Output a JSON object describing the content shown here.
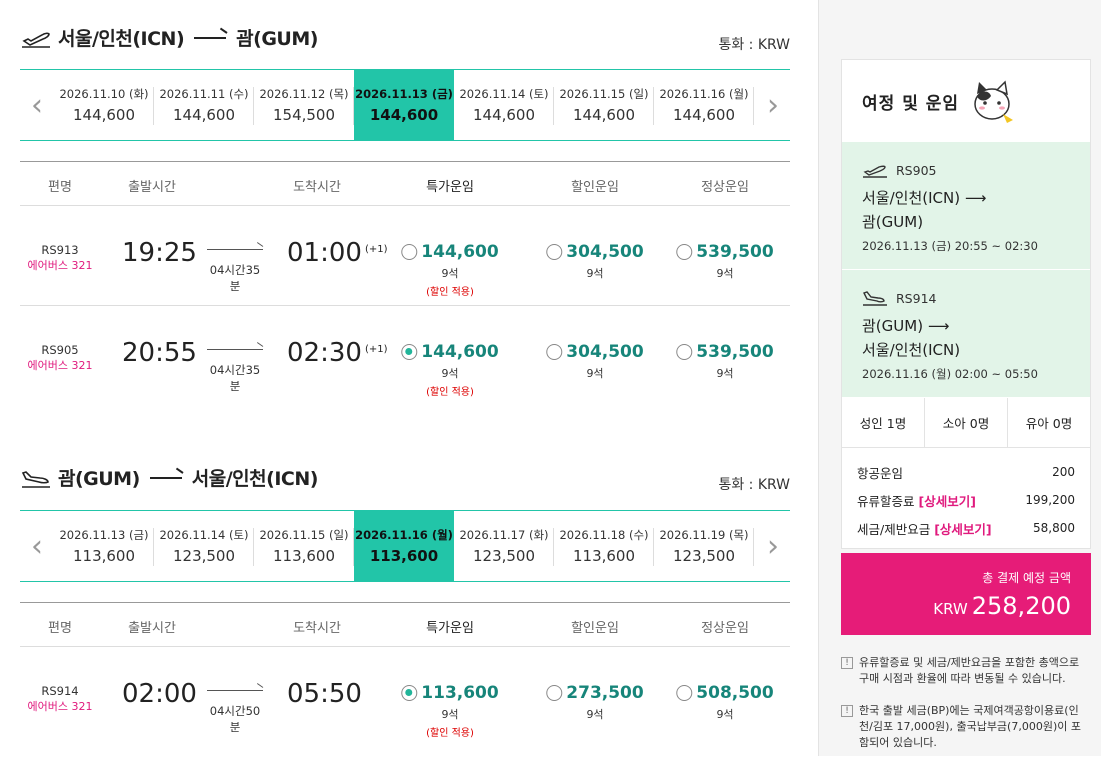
{
  "outbound": {
    "title_from": "서울/인천(ICN)",
    "title_to": "괌(GUM)",
    "currency": "통화 : KRW",
    "dates": [
      {
        "date": "2026.11.10 (화)",
        "price": "144,600"
      },
      {
        "date": "2026.11.11 (수)",
        "price": "144,600"
      },
      {
        "date": "2026.11.12 (목)",
        "price": "154,500"
      },
      {
        "date": "2026.11.13 (금)",
        "price": "144,600"
      },
      {
        "date": "2026.11.14 (토)",
        "price": "144,600"
      },
      {
        "date": "2026.11.15 (일)",
        "price": "144,600"
      },
      {
        "date": "2026.11.16 (월)",
        "price": "144,600"
      }
    ],
    "headers": [
      "편명",
      "출발시간",
      "도착시간",
      "특가운임",
      "할인운임",
      "정상운임"
    ],
    "flights": [
      {
        "no": "RS913",
        "aircraft": "에어버스 321",
        "dep": "19:25",
        "arr": "01:00",
        "next": "(+1)",
        "dur": "04시간35분",
        "special": "144,600",
        "special_seats": "9석",
        "special_note": "(할인 적용)",
        "discount": "304,500",
        "discount_seats": "9석",
        "normal": "539,500",
        "normal_seats": "9석"
      },
      {
        "no": "RS905",
        "aircraft": "에어버스 321",
        "dep": "20:55",
        "arr": "02:30",
        "next": "(+1)",
        "dur": "04시간35분",
        "special": "144,600",
        "special_seats": "9석",
        "special_note": "(할인 적용)",
        "discount": "304,500",
        "discount_seats": "9석",
        "normal": "539,500",
        "normal_seats": "9석"
      }
    ]
  },
  "inbound": {
    "title_from": "괌(GUM)",
    "title_to": "서울/인천(ICN)",
    "currency": "통화 : KRW",
    "dates": [
      {
        "date": "2026.11.13 (금)",
        "price": "113,600"
      },
      {
        "date": "2026.11.14 (토)",
        "price": "123,500"
      },
      {
        "date": "2026.11.15 (일)",
        "price": "113,600"
      },
      {
        "date": "2026.11.16 (월)",
        "price": "113,600"
      },
      {
        "date": "2026.11.17 (화)",
        "price": "123,500"
      },
      {
        "date": "2026.11.18 (수)",
        "price": "113,600"
      },
      {
        "date": "2026.11.19 (목)",
        "price": "123,500"
      }
    ],
    "headers": [
      "편명",
      "출발시간",
      "도착시간",
      "특가운임",
      "할인운임",
      "정상운임"
    ],
    "flights": [
      {
        "no": "RS914",
        "aircraft": "에어버스 321",
        "dep": "02:00",
        "arr": "05:50",
        "dur": "04시간50분",
        "special": "113,600",
        "special_seats": "9석",
        "special_note": "(할인 적용)",
        "discount": "273,500",
        "discount_seats": "9석",
        "normal": "508,500",
        "normal_seats": "9석"
      }
    ]
  },
  "summary": {
    "title": "여정 및 운임",
    "seg1": {
      "flight": "RS905",
      "route_from": "서울/인천(ICN) ⟶",
      "route_to": "괌(GUM)",
      "when": "2026.11.13 (금) 20:55 ~ 02:30"
    },
    "seg2": {
      "flight": "RS914",
      "route_from": "괌(GUM) ⟶",
      "route_to": "서울/인천(ICN)",
      "when": "2026.11.16 (월) 02:00 ~ 05:50"
    },
    "pax": {
      "adult": "성인 1명",
      "child": "소아 0명",
      "infant": "유아 0명"
    },
    "fees": {
      "airfare_label": "항공운임",
      "airfare": "200",
      "fuel_label": "유류할증료",
      "fuel_link": "[상세보기]",
      "fuel": "199,200",
      "tax_label": "세금/제반요금",
      "tax_link": "[상세보기]",
      "tax": "58,800"
    },
    "total_label": "총 결제 예정 금액",
    "total_currency": "KRW",
    "total": "258,200",
    "note1": "유류할증료 및 세금/제반요금을 포함한 총액으로 구매 시점과 환율에 따라 변동될 수 있습니다.",
    "note2": "한국 출발 세금(BP)에는 국제여객공항이용료(인천/김포 17,000원), 출국납부금(7,000원)이 포함되어 있습니다."
  },
  "colors": {
    "accent": "#22c5a8",
    "price": "#17857a",
    "brand": "#e61c78",
    "segment_bg": "#e2f4e8"
  }
}
